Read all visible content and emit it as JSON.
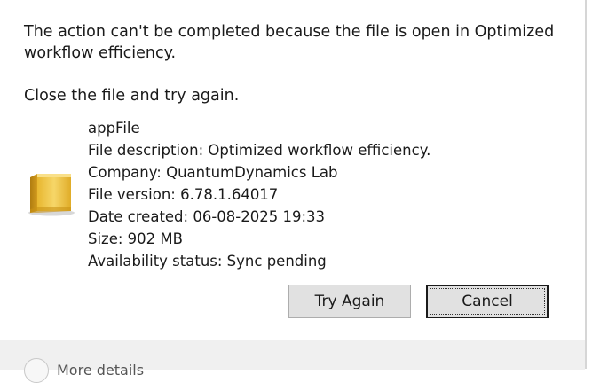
{
  "dialog": {
    "message_line1": "The action can't be completed because the file is open in Optimized",
    "message_line2": "workflow efficiency.",
    "instruction": "Close the file and try again."
  },
  "file": {
    "icon": "file-package-icon",
    "name": "appFile",
    "description": "File description: Optimized workflow efficiency.",
    "company": "Company: QuantumDynamics Lab",
    "version": "File version: 6.78.1.64017",
    "date_created": "Date created: 06-08-2025 19:33",
    "size": "Size: 902 MB",
    "availability": "Availability status: Sync pending"
  },
  "buttons": {
    "try_again": "Try Again",
    "cancel": "Cancel"
  },
  "footer": {
    "more_details": "More details"
  }
}
